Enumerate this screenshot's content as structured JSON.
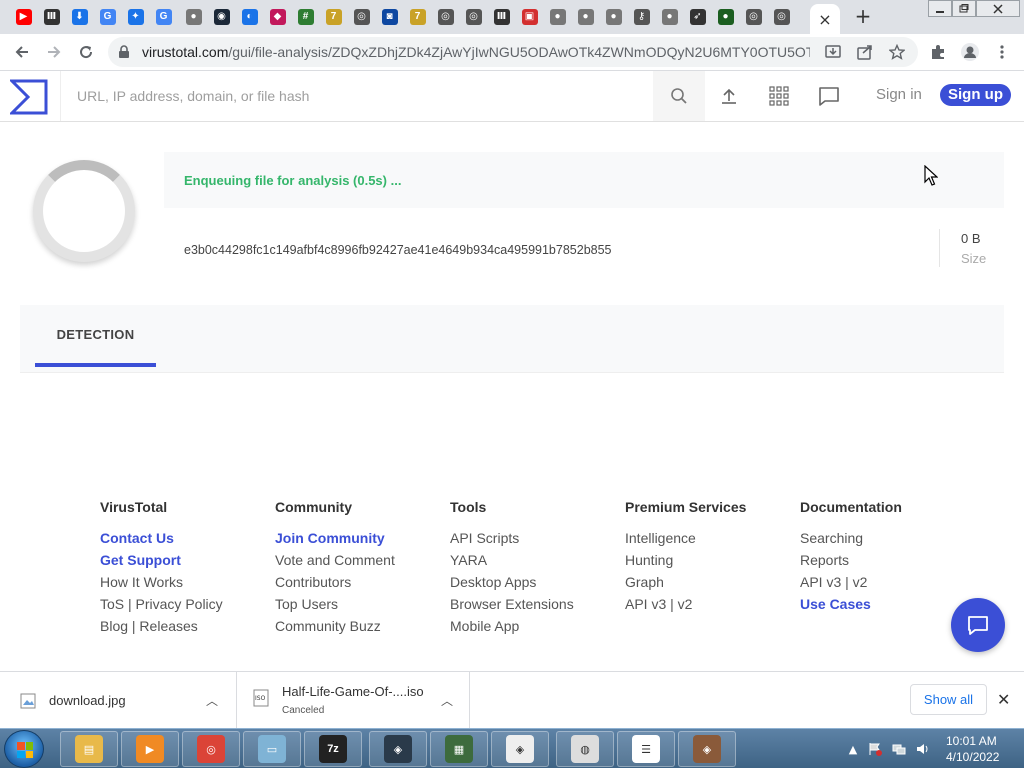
{
  "browser": {
    "tabs": [
      {
        "icon": "youtube-icon",
        "color": "#ff0000"
      },
      {
        "icon": "bank-icon",
        "color": "#333333"
      },
      {
        "icon": "download-icon",
        "color": "#1a73e8"
      },
      {
        "icon": "google-icon",
        "color": "#4285f4"
      },
      {
        "icon": "puzzle-icon",
        "color": "#1a73e8"
      },
      {
        "icon": "google-icon",
        "color": "#4285f4"
      },
      {
        "icon": "globe-icon",
        "color": "#777777"
      },
      {
        "icon": "steam-icon",
        "color": "#1b2838"
      },
      {
        "icon": "firefox-icon",
        "color": "#1a73e8"
      },
      {
        "icon": "gamepad-icon",
        "color": "#c2185b"
      },
      {
        "icon": "grid-icon",
        "color": "#2e7d32"
      },
      {
        "icon": "seven-icon",
        "color": "#c9a227"
      },
      {
        "icon": "chrome-icon",
        "color": "#555555"
      },
      {
        "icon": "target-icon",
        "color": "#0d47a1"
      },
      {
        "icon": "seven-icon",
        "color": "#c9a227"
      },
      {
        "icon": "chrome-icon",
        "color": "#555555"
      },
      {
        "icon": "chrome-icon",
        "color": "#555555"
      },
      {
        "icon": "bank-icon",
        "color": "#333333"
      },
      {
        "icon": "lock-open-icon",
        "color": "#d32f2f"
      },
      {
        "icon": "globe-icon",
        "color": "#777777"
      },
      {
        "icon": "globe-icon",
        "color": "#777777"
      },
      {
        "icon": "globe-icon",
        "color": "#777777"
      },
      {
        "icon": "key-icon",
        "color": "#555555"
      },
      {
        "icon": "globe-icon",
        "color": "#777777"
      },
      {
        "icon": "rocket-icon",
        "color": "#333333"
      },
      {
        "icon": "radar-icon",
        "color": "#1b5e20"
      },
      {
        "icon": "chrome-icon",
        "color": "#555555"
      },
      {
        "icon": "chrome-icon",
        "color": "#555555"
      }
    ],
    "active_tab_close": "×",
    "new_tab": "+",
    "url_host": "virustotal.com",
    "url_path": "/gui/file-analysis/ZDQxZDhjZDk4ZjAwYjIwNGU5ODAwOTk4ZWNmODQyN2U6MTY0OTU5OT..."
  },
  "vt": {
    "search_placeholder": "URL, IP address, domain, or file hash",
    "sign_in": "Sign in",
    "sign_up": "Sign up",
    "accent_color": "#3b4fd6",
    "status_text": "Enqueuing file for analysis (0.5s) ...",
    "status_color": "#35b66b",
    "file_hash": "e3b0c44298fc1c149afbf4c8996fb92427ae41e4649b934ca495991b7852b855",
    "size_value": "0 B",
    "size_label": "Size",
    "tab_detection": "DETECTION"
  },
  "footer": {
    "columns": [
      {
        "title": "VirusTotal",
        "links": [
          "Contact Us",
          "Get Support",
          "How It Works",
          "ToS | Privacy Policy",
          "Blog | Releases"
        ]
      },
      {
        "title": "Community",
        "links": [
          "Join Community",
          "Vote and Comment",
          "Contributors",
          "Top Users",
          "Community Buzz"
        ]
      },
      {
        "title": "Tools",
        "links": [
          "API Scripts",
          "YARA",
          "Desktop Apps",
          "Browser Extensions",
          "Mobile App"
        ]
      },
      {
        "title": "Premium Services",
        "links": [
          "Intelligence",
          "Hunting",
          "Graph",
          "API v3 | v2"
        ]
      },
      {
        "title": "Documentation",
        "links": [
          "Searching",
          "Reports",
          "API v3 | v2",
          "Use Cases"
        ]
      }
    ]
  },
  "downloads": {
    "items": [
      {
        "name": "download.jpg",
        "status": ""
      },
      {
        "name": "Half-Life-Game-Of-....iso",
        "status": "Canceled"
      }
    ],
    "show_all": "Show all"
  },
  "taskbar": {
    "apps": [
      {
        "icon": "explorer-icon",
        "color": "#e8b94a"
      },
      {
        "icon": "media-player-icon",
        "color": "#f08a24"
      },
      {
        "icon": "chrome-icon",
        "color": "#db4437"
      },
      {
        "icon": "notepad-icon",
        "color": "#7fb3d5"
      },
      {
        "icon": "7zip-icon",
        "color": "#222222"
      },
      {
        "icon": "game-icon",
        "color": "#2a3a4a"
      },
      {
        "icon": "monitor-icon",
        "color": "#3d6b3d"
      },
      {
        "icon": "game-icon",
        "color": "#eeeeee"
      },
      {
        "icon": "document-icon",
        "color": "#dddddd"
      },
      {
        "icon": "list-icon",
        "color": "#ffffff"
      },
      {
        "icon": "game-icon",
        "color": "#8a5a3a"
      }
    ],
    "time": "10:01 AM",
    "date": "4/10/2022"
  }
}
